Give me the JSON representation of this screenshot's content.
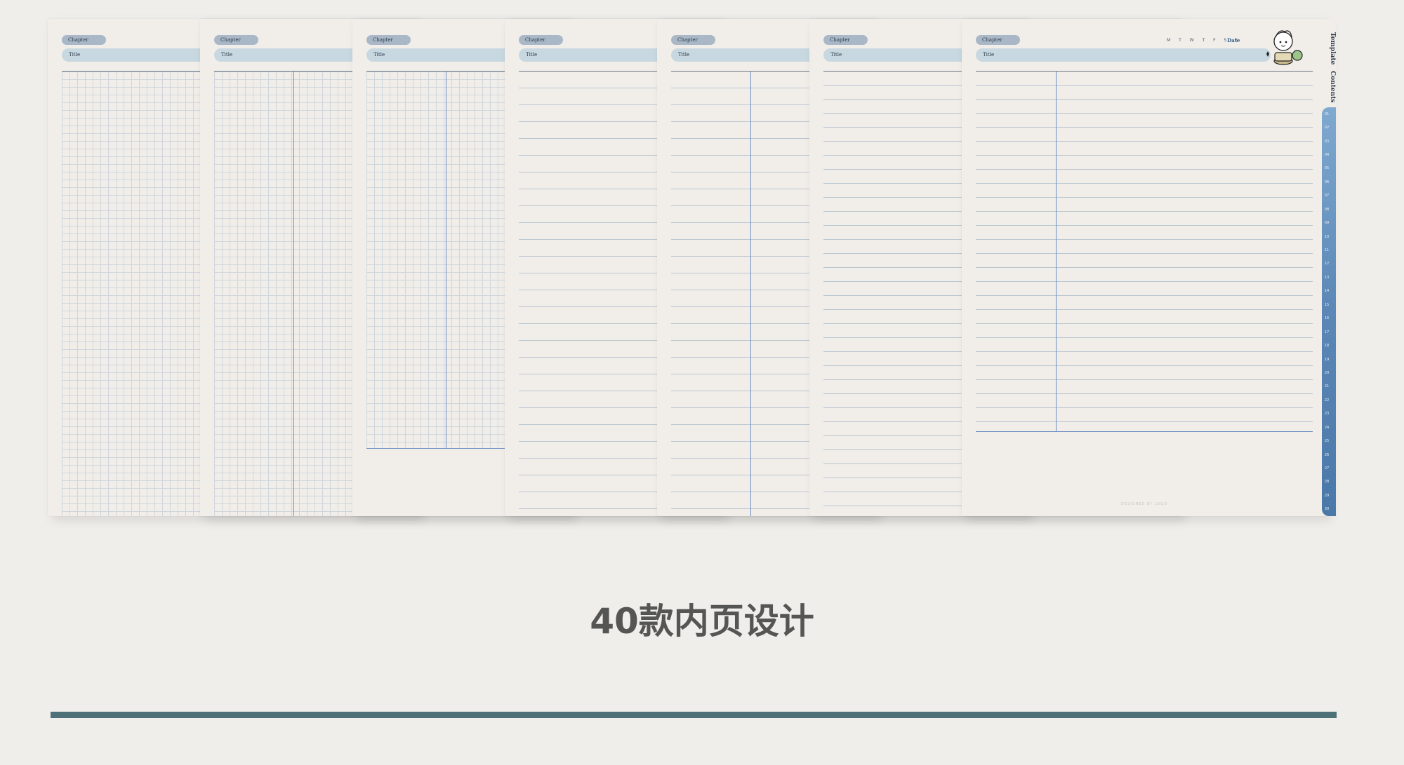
{
  "pages": [
    {
      "chapter": "Chapter",
      "title": "Title",
      "style": "grid"
    },
    {
      "chapter": "Chapter",
      "title": "Title",
      "style": "grid-split"
    },
    {
      "chapter": "Chapter",
      "title": "Title",
      "style": "grid-split-short"
    },
    {
      "chapter": "Chapter",
      "title": "Title",
      "style": "lined"
    },
    {
      "chapter": "Chapter",
      "title": "Title",
      "style": "lined-split"
    },
    {
      "chapter": "Chapter",
      "title": "Title",
      "style": "lined-tight"
    },
    {
      "chapter": "Chapter",
      "title": "Title",
      "style": "cornell"
    }
  ],
  "front_page": {
    "weekdays": "M T W T F S S",
    "date_label": "Date",
    "designed_by": "DESIGNED BY LOGO"
  },
  "side_tabs": {
    "template": "Template",
    "contents": "Contents",
    "numbers": [
      "01",
      "02",
      "03",
      "04",
      "05",
      "06",
      "07",
      "08",
      "09",
      "10",
      "11",
      "12",
      "13",
      "14",
      "15",
      "16",
      "17",
      "18",
      "19",
      "20",
      "21",
      "22",
      "23",
      "24",
      "25",
      "26",
      "27",
      "28",
      "29",
      "30"
    ]
  },
  "headline": "40款内页设计",
  "colors": {
    "background": "#f0eeea",
    "page": "#f1eeea",
    "pill": "#aab7c6",
    "title_bar": "#c8d8e0",
    "accent_blue": "#6e8fc4",
    "bottom_bar": "#4d7079",
    "headline": "#555553"
  }
}
